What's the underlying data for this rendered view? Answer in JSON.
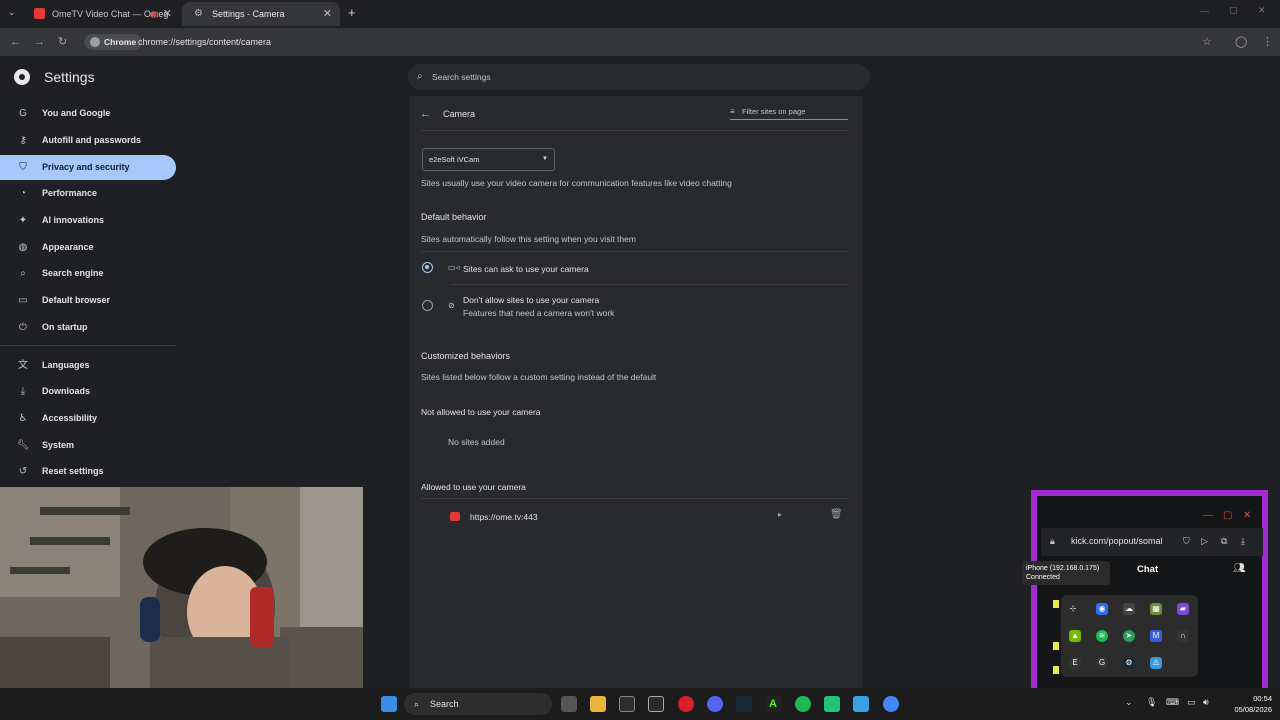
{
  "browser": {
    "tabs": [
      {
        "title": "OmeTV Video Chat — Omeg"
      },
      {
        "title": "Settings - Camera"
      }
    ],
    "chip_label": "Chrome",
    "url": "chrome://settings/content/camera"
  },
  "settings": {
    "title": "Settings",
    "search_placeholder": "Search settings",
    "nav": [
      {
        "label": "You and Google",
        "icon": "google-icon"
      },
      {
        "label": "Autofill and passwords",
        "icon": "key-icon"
      },
      {
        "label": "Privacy and security",
        "icon": "shield-icon",
        "active": true
      },
      {
        "label": "Performance",
        "icon": "speedometer-icon"
      },
      {
        "label": "AI innovations",
        "icon": "sparkle-icon"
      },
      {
        "label": "Appearance",
        "icon": "palette-icon"
      },
      {
        "label": "Search engine",
        "icon": "search-icon"
      },
      {
        "label": "Default browser",
        "icon": "browser-icon"
      },
      {
        "label": "On startup",
        "icon": "power-icon"
      },
      {
        "label": "Languages",
        "icon": "translate-icon"
      },
      {
        "label": "Downloads",
        "icon": "download-icon"
      },
      {
        "label": "Accessibility",
        "icon": "accessibility-icon"
      },
      {
        "label": "System",
        "icon": "wrench-icon"
      },
      {
        "label": "Reset settings",
        "icon": "reset-icon"
      }
    ]
  },
  "camera": {
    "title": "Camera",
    "filter_label": "Filter sites on page",
    "selected_device": "e2eSoft iVCam",
    "description": "Sites usually use your video camera for communication features like video chatting",
    "default_behavior_title": "Default behavior",
    "default_behavior_desc": "Sites automatically follow this setting when you visit them",
    "option_allow": "Sites can ask to use your camera",
    "option_block": "Don't allow sites to use your camera",
    "option_block_sub": "Features that need a camera won't work",
    "customized_title": "Customized behaviors",
    "customized_desc": "Sites listed below follow a custom setting instead of the default",
    "not_allowed_title": "Not allowed to use your camera",
    "no_sites": "No sites added",
    "allowed_title": "Allowed to use your camera",
    "allowed_sites": [
      "https://ome.tv:443"
    ]
  },
  "kick": {
    "url": "kick.com/popout/somal",
    "chat_title": "Chat"
  },
  "tooltip": {
    "line1": "iPhone (192.168.0.175)",
    "line2": "Connected"
  },
  "taskbar": {
    "search": "Search",
    "time": "00:54",
    "date": "05/08/2026"
  },
  "colors": {
    "accent": "#a8c7fa",
    "kick_border": "#a22ccf",
    "ome_red": "#e53935"
  }
}
